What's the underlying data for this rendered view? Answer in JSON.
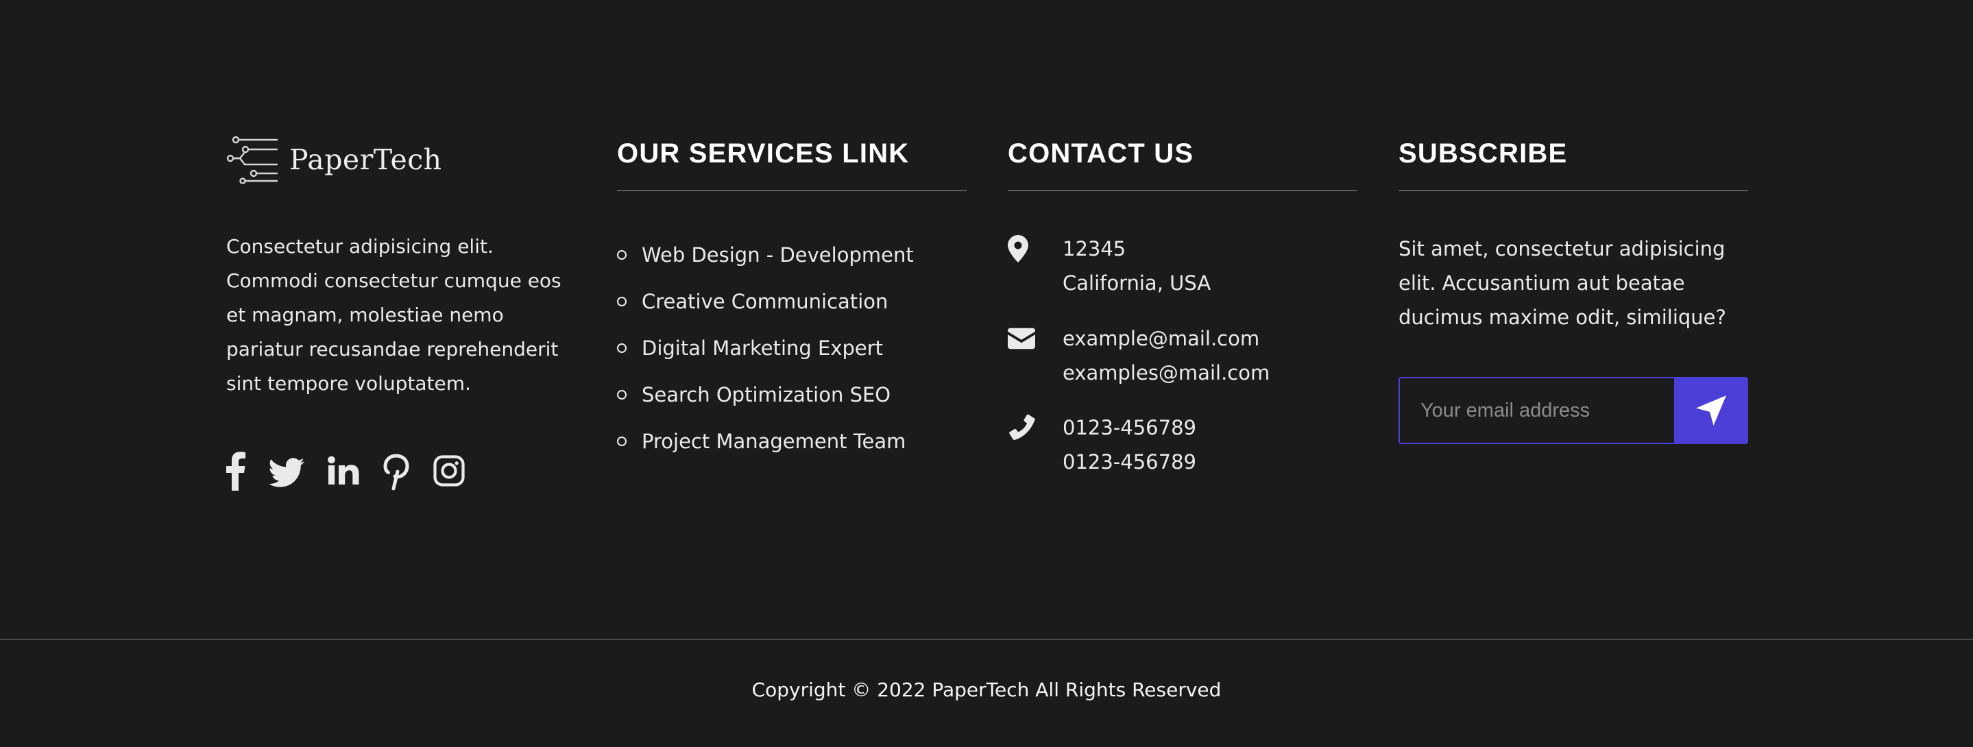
{
  "brand": {
    "name": "PaperTech",
    "logo_icon": "circuit-lines-icon",
    "description": "Consectetur adipisicing elit. Commodi consectetur cumque eos et magnam, molestiae nemo pariatur recusandae reprehenderit sint tempore voluptatem.",
    "socials": [
      {
        "name": "facebook",
        "icon": "facebook-icon"
      },
      {
        "name": "twitter",
        "icon": "twitter-icon"
      },
      {
        "name": "linkedin",
        "icon": "linkedin-icon"
      },
      {
        "name": "pinterest",
        "icon": "pinterest-icon"
      },
      {
        "name": "instagram",
        "icon": "instagram-icon"
      }
    ]
  },
  "services": {
    "heading": "OUR SERVICES LINK",
    "items": [
      "Web Design - Development",
      "Creative Communication",
      "Digital Marketing Expert",
      "Search Optimization SEO",
      "Project Management Team"
    ]
  },
  "contact": {
    "heading": "CONTACT US",
    "address": {
      "icon": "map-pin-icon",
      "line1": "12345",
      "line2": "California, USA"
    },
    "email": {
      "icon": "envelope-icon",
      "line1": "example@mail.com",
      "line2": "examples@mail.com"
    },
    "phone": {
      "icon": "phone-icon",
      "line1": "0123-456789",
      "line2": "0123-456789"
    }
  },
  "subscribe": {
    "heading": "SUBSCRIBE",
    "text": "Sit amet, consectetur adipisicing elit. Accusantium aut beatae ducimus maxime odit, similique?",
    "input_value": "",
    "placeholder": "Your email address",
    "button_icon": "send-arrow-icon"
  },
  "copyright": "Copyright © 2022 PaperTech All Rights Reserved",
  "colors": {
    "background": "#1b1b1b",
    "accent": "#4b3fd8",
    "text": "#eaeaea",
    "divider": "#5b5b5b"
  }
}
